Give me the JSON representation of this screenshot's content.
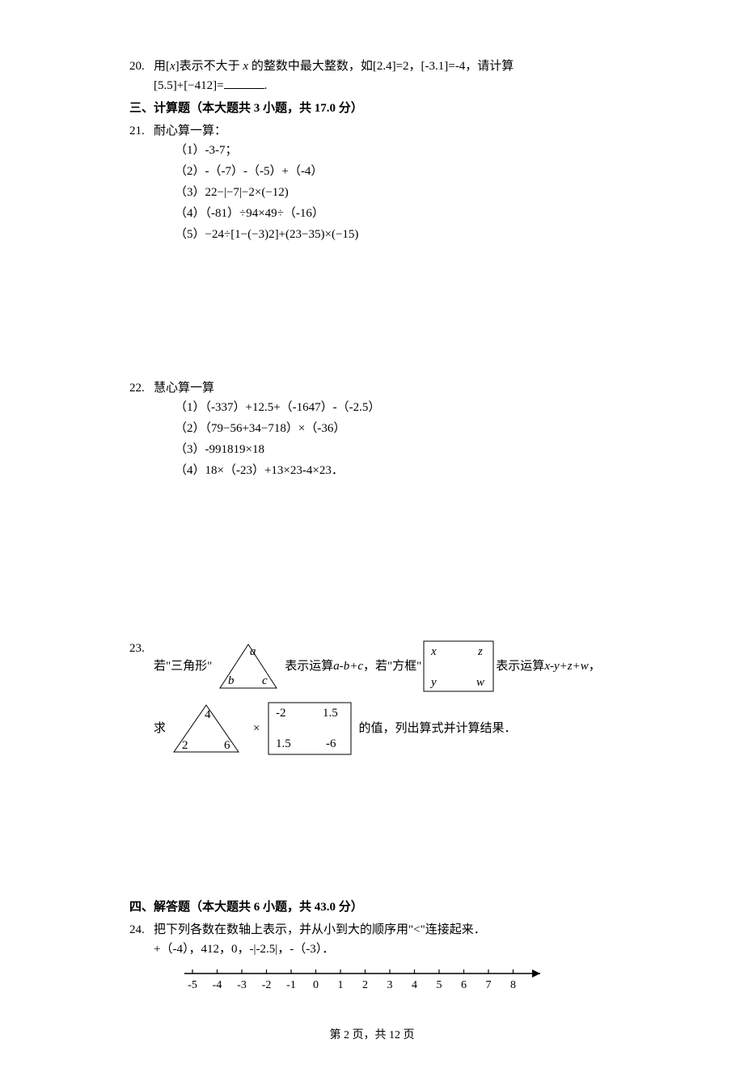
{
  "q20": {
    "num": "20.",
    "text_before_x1": "用[",
    "x1": "x",
    "text_mid1": "]表示不大于 ",
    "x2": "x",
    "text_mid2": " 的整数中最大整数，如[2.4]=2，[-3.1]=-4，请计算",
    "line2": "[5.5]+[−412]=",
    "line2_after": "."
  },
  "section3": "三、计算题（本大题共 3 小题，共 17.0 分）",
  "q21": {
    "num": "21.",
    "lead": "耐心算一算：",
    "items": [
      "（1）-3-7；",
      "（2）-（-7）-（-5）+（-4）",
      "（3）22−|−7|−2×(−12)",
      "（4）（-81）÷94×49÷（-16）",
      "（5）−24÷[1−(−3)2]+(23−35)×(−15)"
    ]
  },
  "q22": {
    "num": "22.",
    "lead": "慧心算一算",
    "items": [
      "（1）（-337）+12.5+（-1647）-（-2.5）",
      "（2）（79−56+34−718）×（-36）",
      "（3）-991819×18",
      "（4）18×（-23）+13×23-4×23．"
    ]
  },
  "q23": {
    "num": "23.",
    "line1_part1": "若\"三角形\"",
    "line1_part2": "表示运算 ",
    "abc": "a-b+c",
    "line1_part3": "，若\"方框\"",
    "line1_part4": "表示运算 ",
    "xyzw": "x-y+z+w",
    "line1_part5": "，",
    "line2_part1": "求",
    "times": "×",
    "line2_part2": "的值，列出算式并计算结果．",
    "tri1": {
      "a": "a",
      "b": "b",
      "c": "c"
    },
    "box1": {
      "x": "x",
      "y": "y",
      "z": "z",
      "w": "w"
    },
    "tri2": {
      "a": "4",
      "b": "2",
      "c": "6"
    },
    "box2": {
      "x": "-2",
      "y": "1.5",
      "z": "1.5",
      "w": "-6"
    }
  },
  "section4": "四、解答题（本大题共 6 小题，共 43.0 分）",
  "q24": {
    "num": "24.",
    "line1": "把下列各数在数轴上表示，并从小到大的顺序用\"<\"连接起来．",
    "line2": "+（-4），412，0，-|-2.5|，-（-3）．",
    "ticks": [
      "-5",
      "-4",
      "-3",
      "-2",
      "-1",
      "0",
      "1",
      "2",
      "3",
      "4",
      "5",
      "6",
      "7",
      "8"
    ]
  },
  "footer": "第 2 页，共 12 页"
}
